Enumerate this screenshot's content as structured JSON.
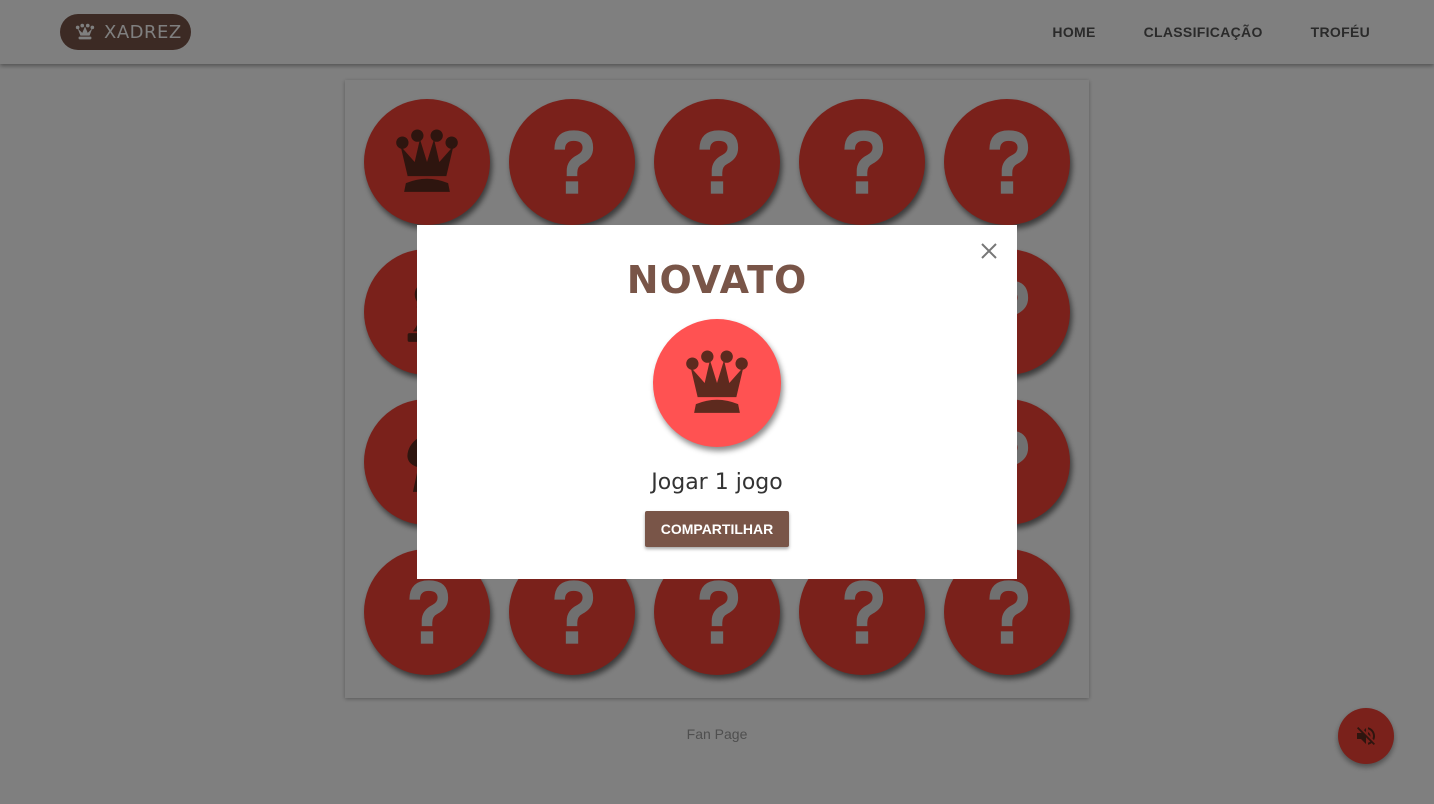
{
  "header": {
    "brand_text": "XADREZ",
    "brand_icon": "chess-queen-icon",
    "nav": [
      {
        "label": "HOME"
      },
      {
        "label": "CLASSIFICAÇÃO"
      },
      {
        "label": "TROFÉU"
      }
    ]
  },
  "trophies": [
    {
      "state": "unlocked",
      "icon": "queen-icon"
    },
    {
      "state": "locked",
      "icon": "question-mark-icon"
    },
    {
      "state": "locked",
      "icon": "question-mark-icon"
    },
    {
      "state": "locked",
      "icon": "question-mark-icon"
    },
    {
      "state": "locked",
      "icon": "question-mark-icon"
    },
    {
      "state": "unlocked",
      "icon": "pawn-icon"
    },
    {
      "state": "locked",
      "icon": "question-mark-icon"
    },
    {
      "state": "locked",
      "icon": "question-mark-icon"
    },
    {
      "state": "locked",
      "icon": "question-mark-icon"
    },
    {
      "state": "locked",
      "icon": "question-mark-icon"
    },
    {
      "state": "unlocked",
      "icon": "knight-icon"
    },
    {
      "state": "locked",
      "icon": "question-mark-icon"
    },
    {
      "state": "locked",
      "icon": "question-mark-icon"
    },
    {
      "state": "locked",
      "icon": "question-mark-icon"
    },
    {
      "state": "locked",
      "icon": "question-mark-icon"
    },
    {
      "state": "locked",
      "icon": "question-mark-icon"
    },
    {
      "state": "locked",
      "icon": "question-mark-icon"
    },
    {
      "state": "locked",
      "icon": "question-mark-icon"
    },
    {
      "state": "locked",
      "icon": "question-mark-icon"
    },
    {
      "state": "locked",
      "icon": "question-mark-icon"
    }
  ],
  "footer": {
    "link_text": "Fan Page"
  },
  "sound_button": {
    "icon": "volume-off-icon"
  },
  "modal": {
    "title": "NOVATO",
    "badge_icon": "queen-icon",
    "description": "Jogar 1 jogo",
    "share_label": "COMPARTILHAR",
    "close_icon": "close-icon"
  },
  "colors": {
    "brand": "#795548",
    "badge_red": "#f44336",
    "badge_highlight": "#ff5252",
    "icon_dark": "#5d2a1e",
    "question_mark": "#e0e0e0"
  }
}
